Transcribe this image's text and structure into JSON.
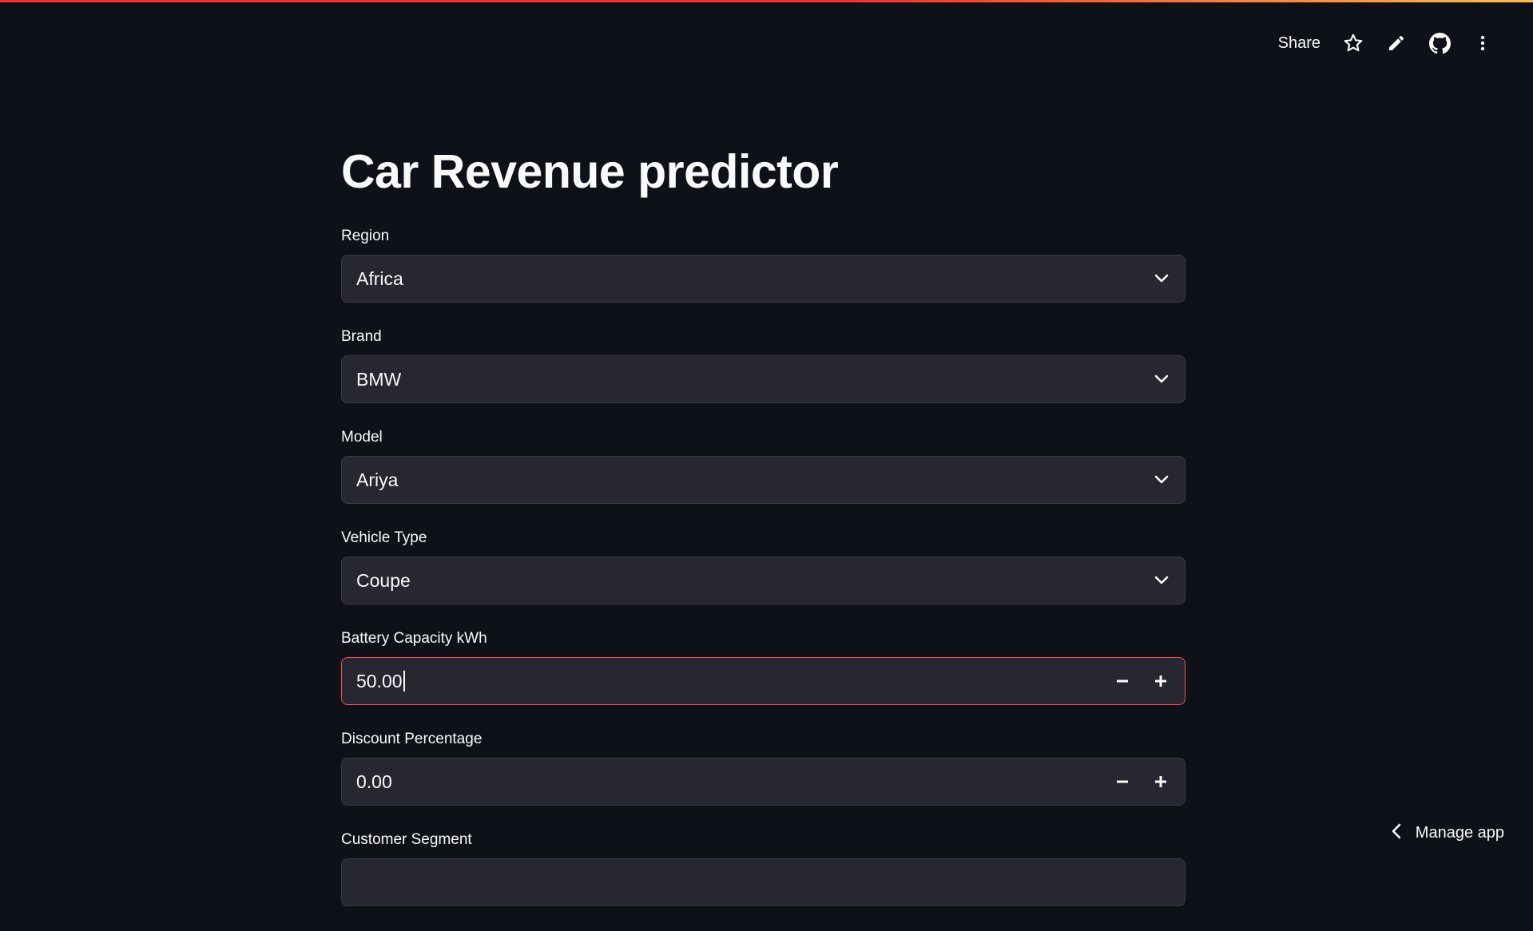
{
  "header": {
    "share_label": "Share",
    "icons": [
      "star-icon",
      "pencil-icon",
      "github-icon",
      "more-vertical-icon"
    ]
  },
  "main": {
    "title": "Car Revenue predictor",
    "fields": [
      {
        "label": "Region",
        "type": "select",
        "value": "Africa"
      },
      {
        "label": "Brand",
        "type": "select",
        "value": "BMW"
      },
      {
        "label": "Model",
        "type": "select",
        "value": "Ariya"
      },
      {
        "label": "Vehicle Type",
        "type": "select",
        "value": "Coupe"
      },
      {
        "label": "Battery Capacity kWh",
        "type": "number",
        "value": "50.00",
        "focused": true
      },
      {
        "label": "Discount Percentage",
        "type": "number",
        "value": "0.00"
      },
      {
        "label": "Customer Segment",
        "type": "select",
        "value": ""
      }
    ]
  },
  "footer": {
    "manage_app_label": "Manage app"
  },
  "colors": {
    "background": "#0e1117",
    "input_bg": "#262730",
    "accent": "#ff4b4b",
    "text": "#fafafa"
  }
}
